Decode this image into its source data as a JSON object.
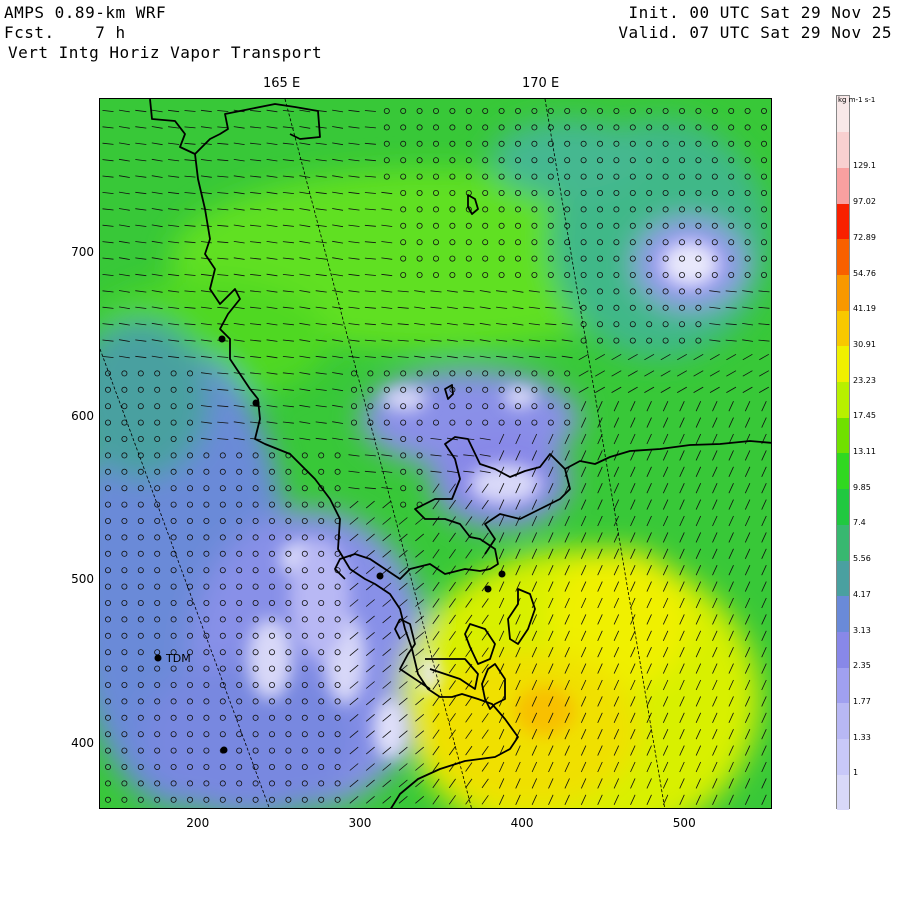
{
  "header": {
    "model": "AMPS 0.89-km WRF",
    "forecast": "Fcst.    7 h",
    "field": "Vert Intg Horiz Vapor Transport",
    "init": "Init. 00 UTC Sat 29 Nov 25",
    "valid": "Valid. 07 UTC Sat 29 Nov 25"
  },
  "map": {
    "lon_labels": [
      "165 E",
      "170 E"
    ],
    "y_ticks": [
      {
        "label": "700",
        "value": 700
      },
      {
        "label": "600",
        "value": 600
      },
      {
        "label": "500",
        "value": 500
      },
      {
        "label": "400",
        "value": 400
      }
    ],
    "x_ticks": [
      {
        "label": "200",
        "value": 200
      },
      {
        "label": "300",
        "value": 300
      },
      {
        "label": "400",
        "value": 400
      },
      {
        "label": "500",
        "value": 500
      }
    ],
    "x_range": [
      140,
      555
    ],
    "y_range": [
      360,
      795
    ],
    "station_label": "TDM",
    "coastline_color": "#000000"
  },
  "colorbar": {
    "unit": "kg m-1 s-1",
    "levels": [
      "1",
      "1.33",
      "1.77",
      "2.35",
      "3.13",
      "4.17",
      "5.56",
      "7.4",
      "9.85",
      "13.11",
      "17.45",
      "23.23",
      "30.91",
      "41.19",
      "54.76",
      "72.89",
      "97.02",
      "129.1"
    ],
    "colors": [
      "#d8d8f8",
      "#c8c8f8",
      "#b8b8f4",
      "#a0a0f0",
      "#8888e8",
      "#6a8ad8",
      "#4aa0a0",
      "#38b870",
      "#20c840",
      "#30d820",
      "#70e000",
      "#b8f000",
      "#f0f000",
      "#f8c800",
      "#f89800",
      "#f86000",
      "#f82000",
      "#f8a0a0",
      "#f8d0d0",
      "#f8e8e8"
    ]
  }
}
